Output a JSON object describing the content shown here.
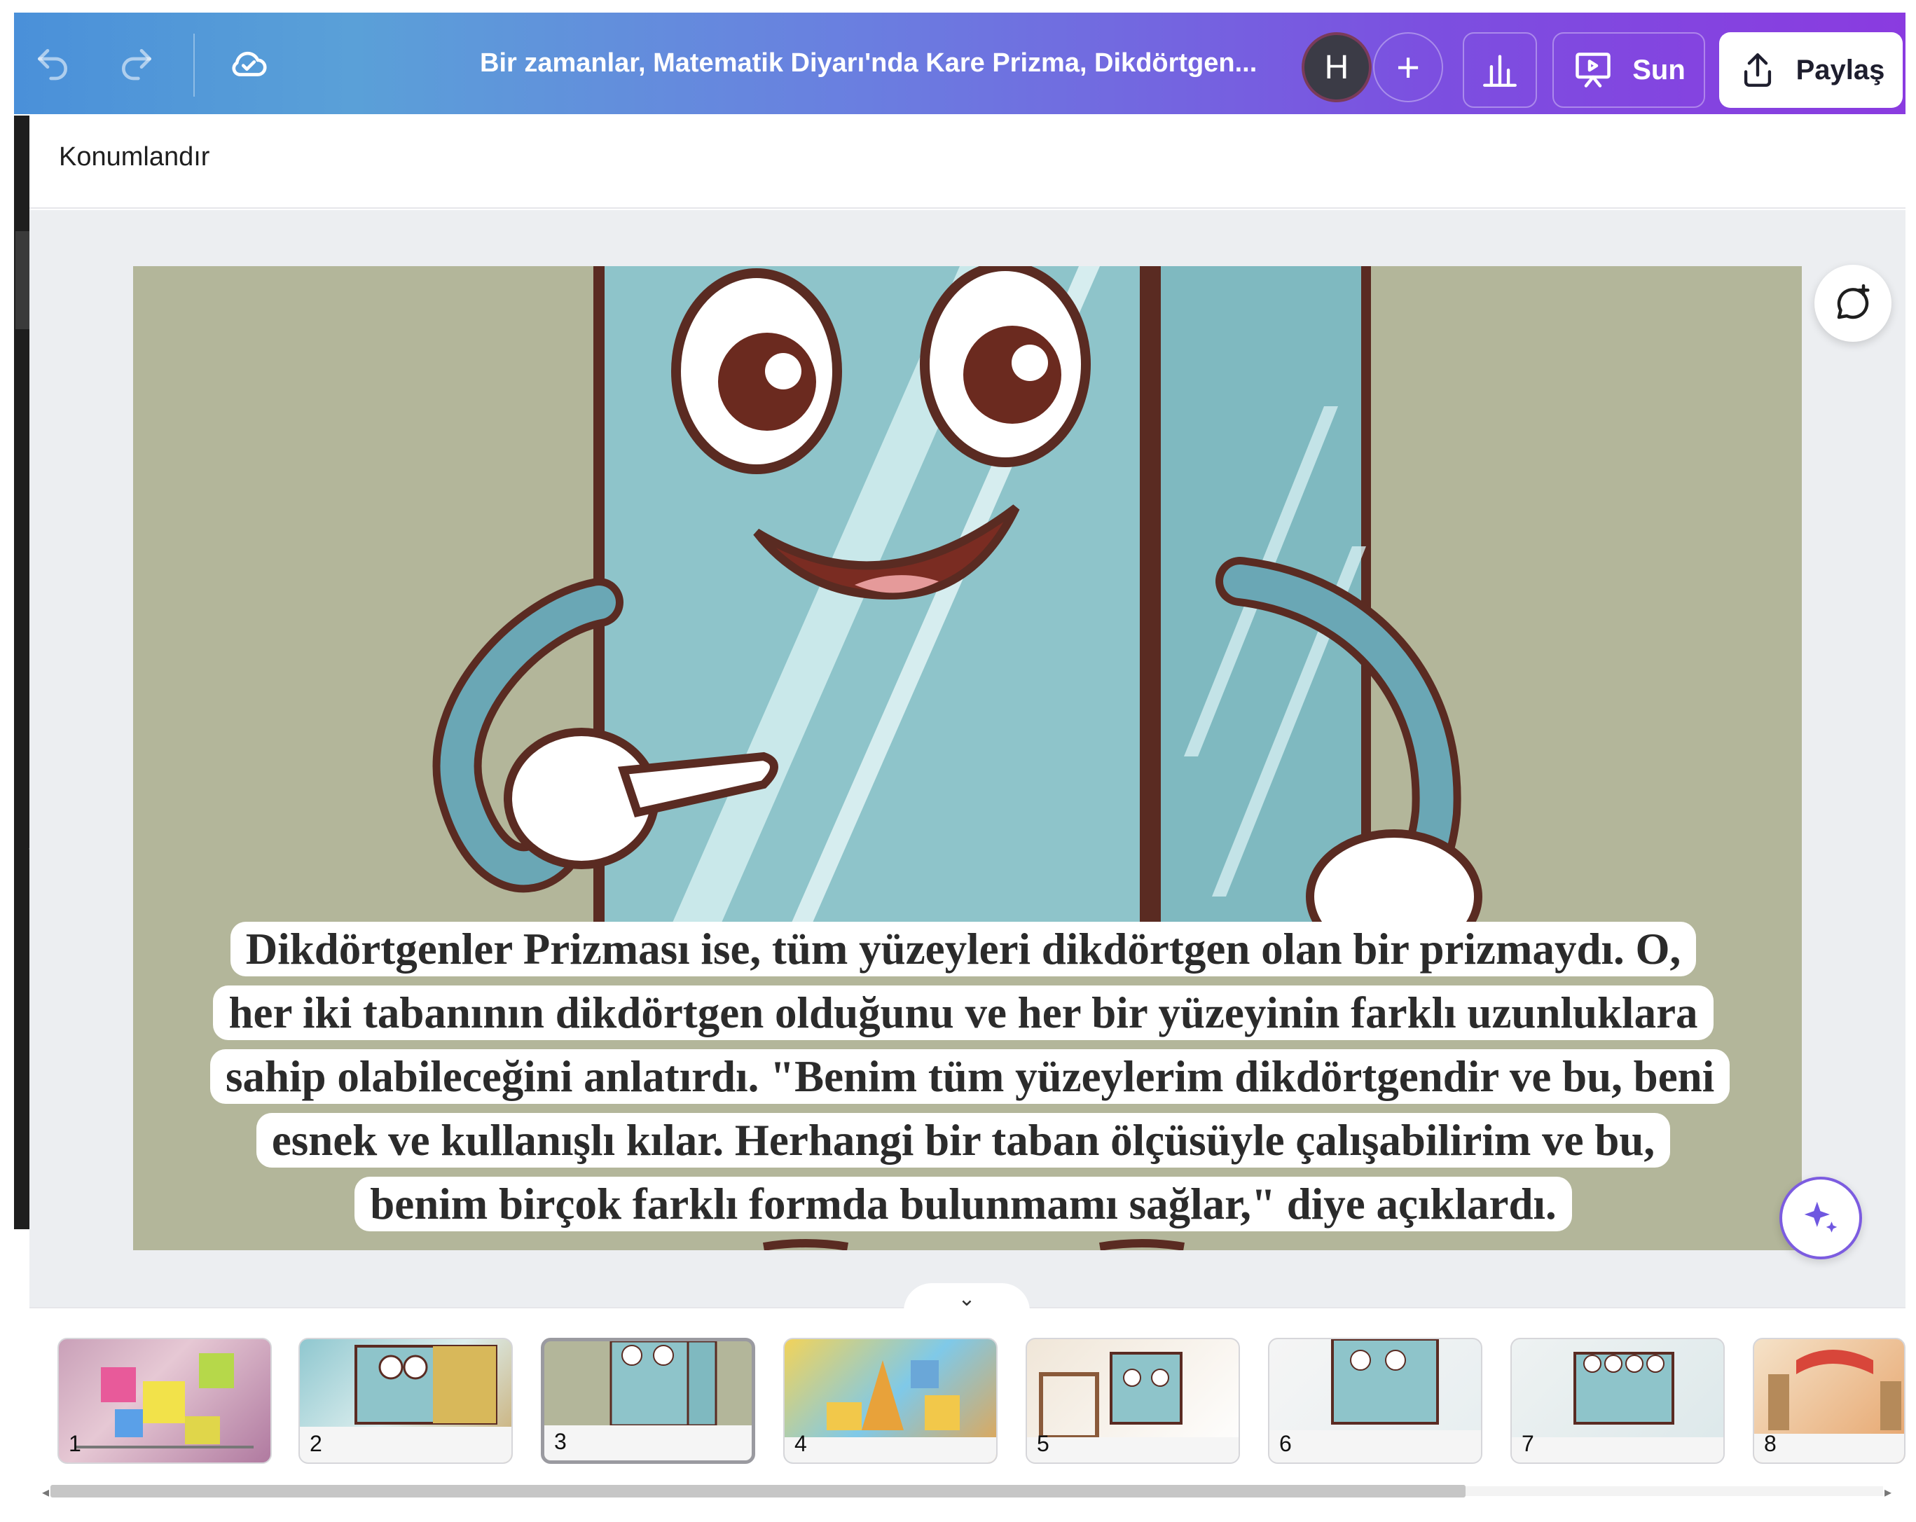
{
  "topbar": {
    "undo_icon": "undo-icon",
    "redo_icon": "redo-icon",
    "saved_icon": "cloud-check-icon",
    "title": "Bir zamanlar, Matematik Diyarı'nda Kare Prizma, Dikdörtgen...",
    "avatar_initial": "H",
    "add_icon": "+",
    "present_label": "Sun",
    "share_label": "Paylaş"
  },
  "toolbar": {
    "position_label": "Konumlandır"
  },
  "slide": {
    "caption": "Dikdörtgenler Prizması ise, tüm yüzeyleri dikdörtgen olan bir prizmaydı. O, her iki tabanının dikdörtgen olduğunu ve her bir yüzeyinin farklı uzunluklara sahip olabileceğini anlatırdı. \"Benim tüm yüzeylerim dikdörtgendir ve bu, beni esnek ve kullanışlı kılar. Herhangi bir taban ölçüsüyle çalışabilirim ve bu, benim birçok farklı formda bulunmamı sağlar,\" diye açıklardı.",
    "bg_color": "#b3b69a"
  },
  "filmstrip": {
    "toggle_icon": "⌄",
    "active_index": 3,
    "thumbnails": [
      {
        "number": "1"
      },
      {
        "number": "2"
      },
      {
        "number": "3"
      },
      {
        "number": "4"
      },
      {
        "number": "5"
      },
      {
        "number": "6"
      },
      {
        "number": "7"
      },
      {
        "number": "8"
      }
    ]
  },
  "colors": {
    "brand_gradient_start": "#4a90d9",
    "brand_gradient_end": "#8a3be0",
    "accent_purple": "#7c5ce0"
  }
}
